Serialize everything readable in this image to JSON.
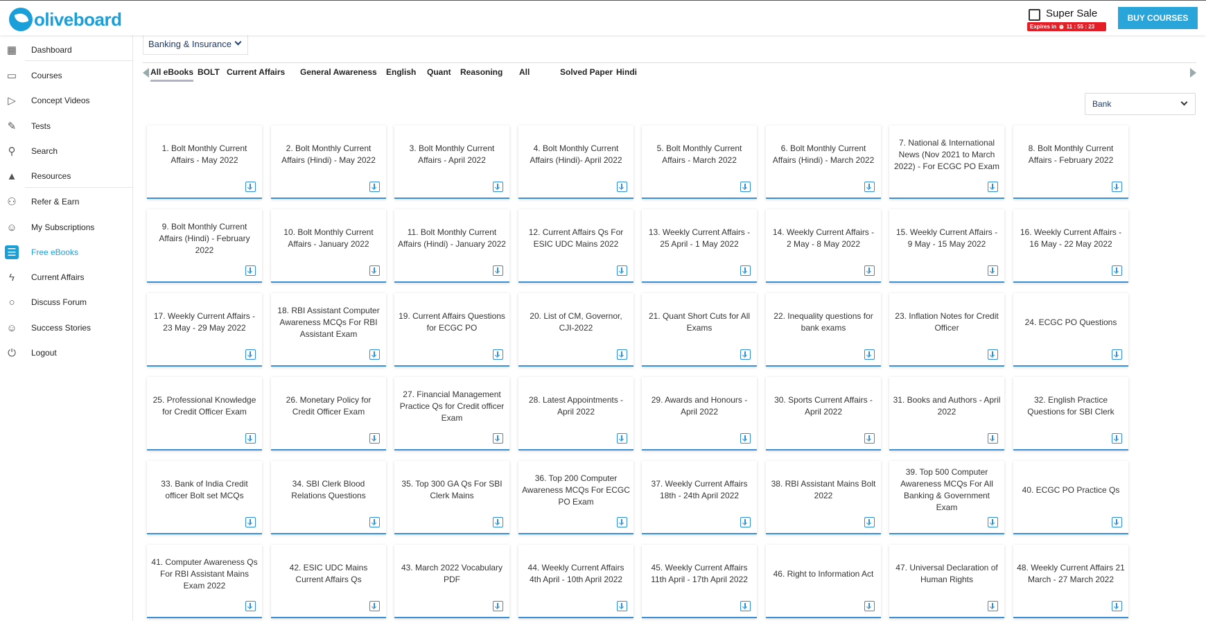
{
  "header": {
    "logo_text": "oliveboard",
    "sale_title": "Super Sale",
    "sale_timer": "Expires in ⏰ 11 : 55 : 23",
    "buy_label": "BUY COURSES"
  },
  "sidebar": {
    "items": [
      {
        "label": "Dashboard",
        "icon": "dashboard-icon",
        "glyph": "▦"
      },
      {
        "label": "Courses",
        "icon": "monitor-icon",
        "glyph": "▭"
      },
      {
        "label": "Concept Videos",
        "icon": "video-icon",
        "glyph": "▷"
      },
      {
        "label": "Tests",
        "icon": "pencil-icon",
        "glyph": "✎"
      },
      {
        "label": "Search",
        "icon": "search-icon",
        "glyph": "⚲"
      },
      {
        "label": "Resources",
        "icon": "rocket-icon",
        "glyph": "▲"
      },
      {
        "label": "Refer & Earn",
        "icon": "refer-icon",
        "glyph": "⚇"
      },
      {
        "label": "My Subscriptions",
        "icon": "user-icon",
        "glyph": "☺"
      },
      {
        "label": "Free eBooks",
        "icon": "ebook-icon",
        "glyph": "☰"
      },
      {
        "label": "Current Affairs",
        "icon": "lightning-icon",
        "glyph": "ϟ"
      },
      {
        "label": "Discuss Forum",
        "icon": "chat-icon",
        "glyph": "○"
      },
      {
        "label": "Success Stories",
        "icon": "person-icon",
        "glyph": "☺"
      },
      {
        "label": "Logout",
        "icon": "power-icon",
        "glyph": "⏻"
      }
    ],
    "active": "Free eBooks"
  },
  "category_dropdown": {
    "value": "Banking & Insurance"
  },
  "tabs": [
    "All eBooks",
    "BOLT",
    "Current Affairs",
    "General Awareness",
    "English",
    "Quant",
    "Reasoning",
    "All",
    "Solved Paper",
    "Hindi"
  ],
  "filter": {
    "value": "Bank"
  },
  "ebooks": [
    "1. Bolt Monthly Current Affairs - May 2022",
    "2. Bolt Monthly Current Affairs (Hindi) - May 2022",
    "3. Bolt Monthly Current Affairs - April 2022",
    "4. Bolt Monthly Current Affairs (Hindi)- April 2022",
    "5. Bolt Monthly Current Affairs - March 2022",
    "6. Bolt Monthly Current Affairs (Hindi) - March 2022",
    "7. National & International News (Nov 2021 to March 2022) - For ECGC PO Exam",
    "8. Bolt Monthly Current Affairs - February 2022",
    "9. Bolt Monthly Current Affairs (Hindi) - February 2022",
    "10. Bolt Monthly Current Affairs - January 2022",
    "11. Bolt Monthly Current Affairs (Hindi) - January 2022",
    "12. Current Affairs Qs For ESIC UDC Mains 2022",
    "13. Weekly Current Affairs - 25 April - 1 May 2022",
    "14. Weekly Current Affairs - 2 May - 8 May 2022",
    "15. Weekly Current Affairs - 9 May - 15 May 2022",
    "16. Weekly Current Affairs - 16 May - 22 May 2022",
    "17. Weekly Current Affairs - 23 May - 29 May 2022",
    "18. RBI Assistant Computer Awareness MCQs For RBI Assistant Exam",
    "19. Current Affairs Questions for ECGC PO",
    "20. List of CM, Governor, CJI-2022",
    "21. Quant Short Cuts for All Exams",
    "22. Inequality questions for bank exams",
    "23. Inflation Notes for Credit Officer",
    "24. ECGC PO Questions",
    "25. Professional Knowledge for Credit Officer Exam",
    "26. Monetary Policy for Credit Officer Exam",
    "27. Financial Management Practice Qs for Credit officer Exam",
    "28. Latest Appointments - April 2022",
    "29. Awards and Honours - April 2022",
    "30. Sports Current Affairs - April 2022",
    "31. Books and Authors - April 2022",
    "32. English Practice Questions for SBI Clerk",
    "33. Bank of India Credit officer Bolt set MCQs",
    "34. SBI Clerk Blood Relations Questions",
    "35. Top 300 GA Qs For SBI Clerk Mains",
    "36. Top 200 Computer Awareness MCQs For ECGC PO Exam",
    "37. Weekly Current Affairs 18th - 24th April 2022",
    "38. RBI Assistant Mains Bolt 2022",
    "39. Top 500 Computer Awareness MCQs For All Banking & Government Exam",
    "40. ECGC PO Practice Qs",
    "41. Computer Awareness Qs For RBI Assistant Mains Exam 2022",
    "42. ESIC UDC Mains Current Affairs Qs",
    "43. March 2022 Vocabulary PDF",
    "44. Weekly Current Affairs 4th April - 10th April 2022",
    "45. Weekly Current Affairs 11th April - 17th April 2022",
    "46. Right to Information Act",
    "47. Universal Declaration of Human Rights",
    "48. Weekly Current Affairs 21 March - 27 March 2022"
  ]
}
